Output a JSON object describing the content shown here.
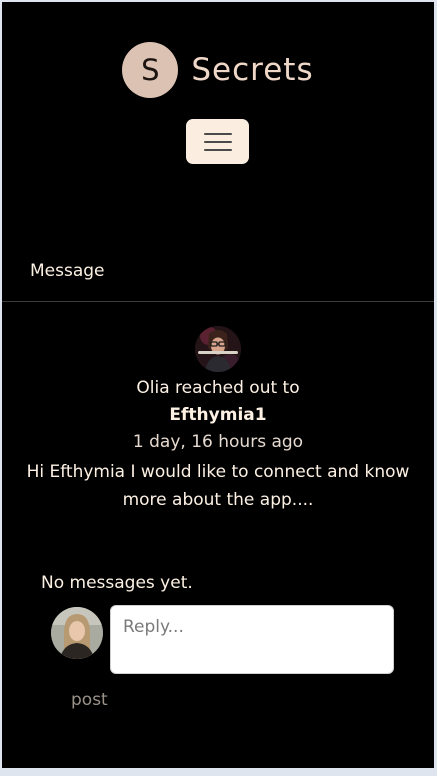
{
  "brand": {
    "logo_letter": "S",
    "name": "Secrets"
  },
  "nav": {
    "toggle_icon": "hamburger-icon"
  },
  "section": {
    "label": "Message"
  },
  "message": {
    "sender_line": "Olia reached out to",
    "recipient": "Efthymia1",
    "time_ago": "1 day, 16 hours ago",
    "body": "Hi Efthymia I would like to connect and know more about the app...."
  },
  "replies": {
    "empty_text": "No messages yet."
  },
  "reply_form": {
    "placeholder": "Reply...",
    "post_label": "post"
  },
  "colors": {
    "background": "#000000",
    "text": "#fdf1e4",
    "logo_circle": "#dcc2b3",
    "toggle_button": "#fbeee1"
  }
}
